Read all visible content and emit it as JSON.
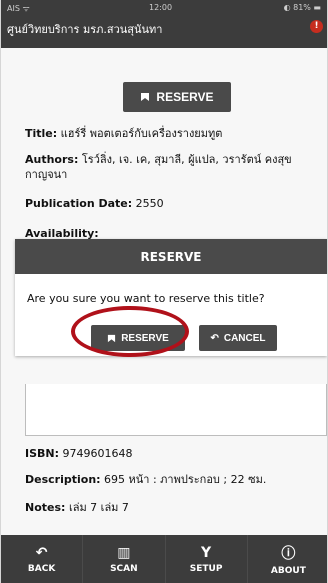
{
  "status_bar": {
    "carrier": "AIS",
    "time": "12:00",
    "battery": "81%"
  },
  "header": {
    "title": "ศูนย์วิทยบริการ มรภ.สวนสุนันทา"
  },
  "main": {
    "reserve_button_label": "RESERVE",
    "fields": {
      "title_label": "Title:",
      "title_value": "แฮร์รี่ พอตเตอร์กับเครื่องรางยมทูต",
      "authors_label": "Authors:",
      "authors_value": "โรว์ลิ่ง, เจ. เค, สุมาลี, ผู้แปล, วรารัตน์ คงสุขกาญจนา",
      "publication_label": "Publication Date:",
      "publication_value": "2550",
      "availability_label": "Availability:",
      "isbn_label": "ISBN:",
      "isbn_value": "9749601648",
      "description_label": "Description:",
      "description_value": "695 หน้า : ภาพประกอบ ; 22 ซม.",
      "notes_label": "Notes:",
      "notes_value": "เล่ม 7 เล่ม 7"
    }
  },
  "dialog": {
    "title": "RESERVE",
    "message": "Are you sure you want to reserve this title?",
    "reserve_label": "RESERVE",
    "cancel_label": "CANCEL"
  },
  "navbar": {
    "items": [
      {
        "label": "BACK",
        "icon": "back-arrow-icon"
      },
      {
        "label": "SCAN",
        "icon": "barcode-icon"
      },
      {
        "label": "SETUP",
        "icon": "wrench-icon"
      },
      {
        "label": "ABOUT",
        "icon": "info-icon"
      }
    ]
  },
  "colors": {
    "header_bg": "#3c3c3c",
    "button_bg": "#4a4a4a",
    "highlight": "#b0111a",
    "info_badge": "#c62d1f"
  }
}
